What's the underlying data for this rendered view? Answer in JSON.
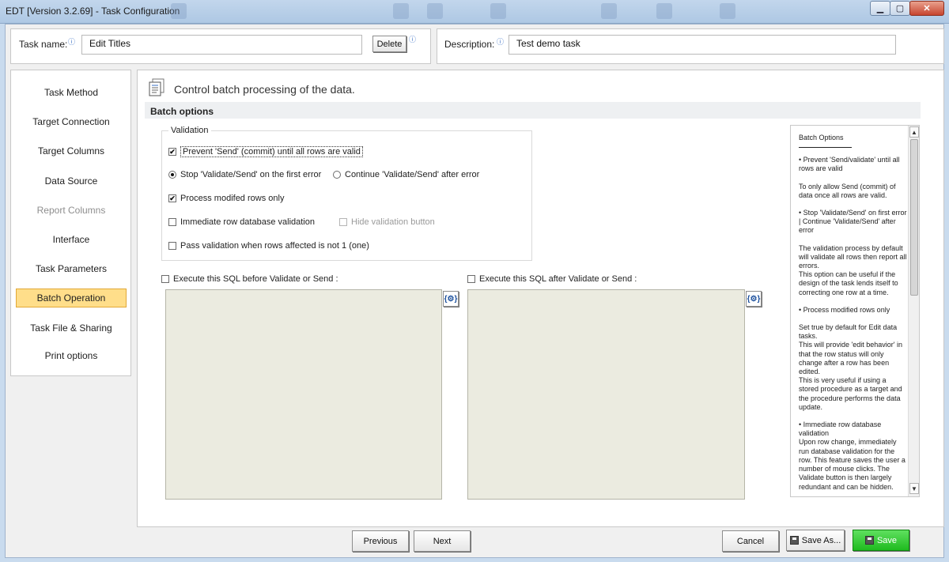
{
  "window": {
    "title": "EDT [Version 3.2.69] - Task Configuration",
    "minimize": "▁",
    "maximize": "▢",
    "close": "✕"
  },
  "header": {
    "task_name_label": "Task name:",
    "task_name_value": "Edit Titles",
    "delete_label": "Delete",
    "description_label": "Description:",
    "description_value": "Test demo task",
    "info_glyph": "ⓘ"
  },
  "sidebar": {
    "items": [
      {
        "label": "Task Method"
      },
      {
        "label": "Target Connection"
      },
      {
        "label": "Target Columns"
      },
      {
        "label": "Data Source"
      },
      {
        "label": "Report Columns"
      },
      {
        "label": "Interface"
      },
      {
        "label": "Task Parameters"
      },
      {
        "label": "Batch Operation"
      },
      {
        "label": "Task File & Sharing"
      },
      {
        "label": "Print options"
      }
    ],
    "active_index": 7,
    "disabled_index": 4
  },
  "main": {
    "heading": "Control batch processing of the data.",
    "section_title": "Batch options",
    "validation": {
      "group_title": "Validation",
      "prevent_send": "Prevent 'Send' (commit) until all rows are valid",
      "stop_on_first": "Stop 'Validate/Send' on the first error",
      "continue_after": "Continue 'Validate/Send' after error",
      "process_modified": "Process modifed rows only",
      "immediate_validation": "Immediate row database validation",
      "hide_validation_button": "Hide validation button",
      "pass_validation": "Pass validation when rows affected is not 1 (one)",
      "checked_mark": "✔"
    },
    "sql_before_label": "Execute this SQL before Validate or Send :",
    "sql_after_label": "Execute this SQL after Validate or Send :",
    "sql_param_button": "{⚙}"
  },
  "help": {
    "title": "Batch Options",
    "paragraphs": [
      "• Prevent 'Send/validate' until all rows are valid",
      "To only allow Send (commit) of data once all rows are valid.",
      "• Stop 'Validate/Send' on first error | Continue 'Validate/Send' after error",
      "The validation process by default will validate all rows then report all errors.\nThis option can be useful if the design of the task lends itself to correcting one row at a time.",
      "• Process modified rows only",
      "Set true by default for Edit data tasks.\nThis will provide 'edit behavior' in that the row status will only change after a row has been edited.\nThis is very useful if using a stored procedure as a target and the procedure performs the data update.",
      "• Immediate row database validation\nUpon row change, immediately run database validation for the row.  This feature saves the user a number of mouse clicks.  The Validate button is then largely redundant and can be hidden."
    ],
    "scroll_up": "▲",
    "scroll_down": "▼"
  },
  "footer": {
    "previous": "Previous",
    "next": "Next",
    "cancel": "Cancel",
    "save_as": "Save As...",
    "save": "Save"
  }
}
